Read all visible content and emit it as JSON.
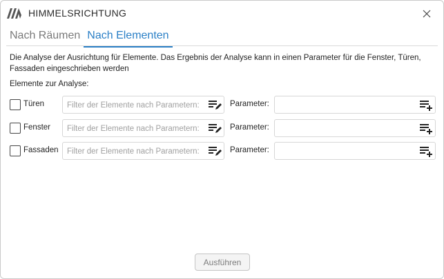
{
  "window": {
    "title": "HIMMELSRICHTUNG",
    "logo_icon": "brand-logo-icon",
    "close_icon": "close-icon"
  },
  "tabs": [
    {
      "label": "Nach Räumen",
      "active": false
    },
    {
      "label": "Nach Elementen",
      "active": true
    }
  ],
  "description": "Die Analyse der Ausrichtung für Elemente. Das Ergebnis der Analyse kann in einen Parameter für die Fenster, Türen, Fassaden eingeschrieben werden",
  "section_label": "Elemente zur Analyse:",
  "rows": [
    {
      "label": "Türen",
      "checked": false,
      "filter_placeholder": "Filter der Elemente nach Parametern:",
      "filter_value": "",
      "filter_icon": "edit-list-icon",
      "param_label": "Parameter:",
      "param_value": "",
      "param_icon": "add-to-list-icon"
    },
    {
      "label": "Fenster",
      "checked": false,
      "filter_placeholder": "Filter der Elemente nach Parametern:",
      "filter_value": "",
      "filter_icon": "edit-list-icon",
      "param_label": "Parameter:",
      "param_value": "",
      "param_icon": "add-to-list-icon"
    },
    {
      "label": "Fassaden",
      "checked": false,
      "filter_placeholder": "Filter der Elemente nach Parametern:",
      "filter_value": "",
      "filter_icon": "edit-list-icon",
      "param_label": "Parameter:",
      "param_value": "",
      "param_icon": "add-to-list-icon"
    }
  ],
  "run_button": {
    "label": "Ausführen",
    "enabled": false
  },
  "colors": {
    "accent": "#2a7fc6",
    "tab_inactive": "#7a7a7a",
    "border": "#d6d6d6",
    "button_disabled_text": "#7c7c7c"
  }
}
